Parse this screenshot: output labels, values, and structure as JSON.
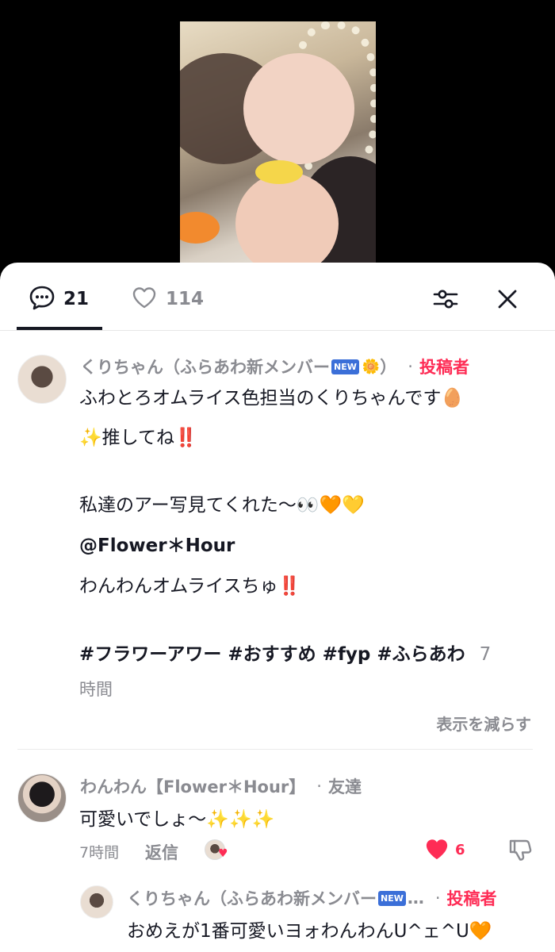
{
  "video": {
    "description_icon": "video-thumbnail"
  },
  "tabs": {
    "comments_count": "21",
    "likes_count": "114"
  },
  "comment1": {
    "username": "くりちゃん（ふらあわ新メンバー",
    "new_badge": "NEW",
    "flower": "🌼",
    "username_close": "）",
    "tag": "投稿者",
    "lines": [
      "ふわとろオムライス色担当のくりちゃんです🥚",
      "✨推してね‼️",
      "私達のアー写見てくれた〜👀🧡💛",
      "@Flower＊Hour",
      "わんわんオムライスちゅ‼️",
      "#フラワーアワー #おすすめ #fyp #ふらあわ"
    ],
    "time_part1": "7",
    "time_part2": "時間",
    "show_less": "表示を減らす"
  },
  "comment2": {
    "username": "わんわん【Flower＊Hour】",
    "tag": "友達",
    "text": "可愛いでしょ〜✨✨✨",
    "time": "7時間",
    "reply": "返信",
    "likes": "6"
  },
  "reply1": {
    "username": "くりちゃん（ふらあわ新メンバー",
    "new_badge": "NEW",
    "ellipsis": "…",
    "tag": "投稿者",
    "text": "おめえが1番可愛いヨォわんわんU^ェ^U🧡"
  },
  "colors": {
    "accent": "#fe2c55",
    "text": "#161823",
    "muted": "#8a8b91"
  }
}
